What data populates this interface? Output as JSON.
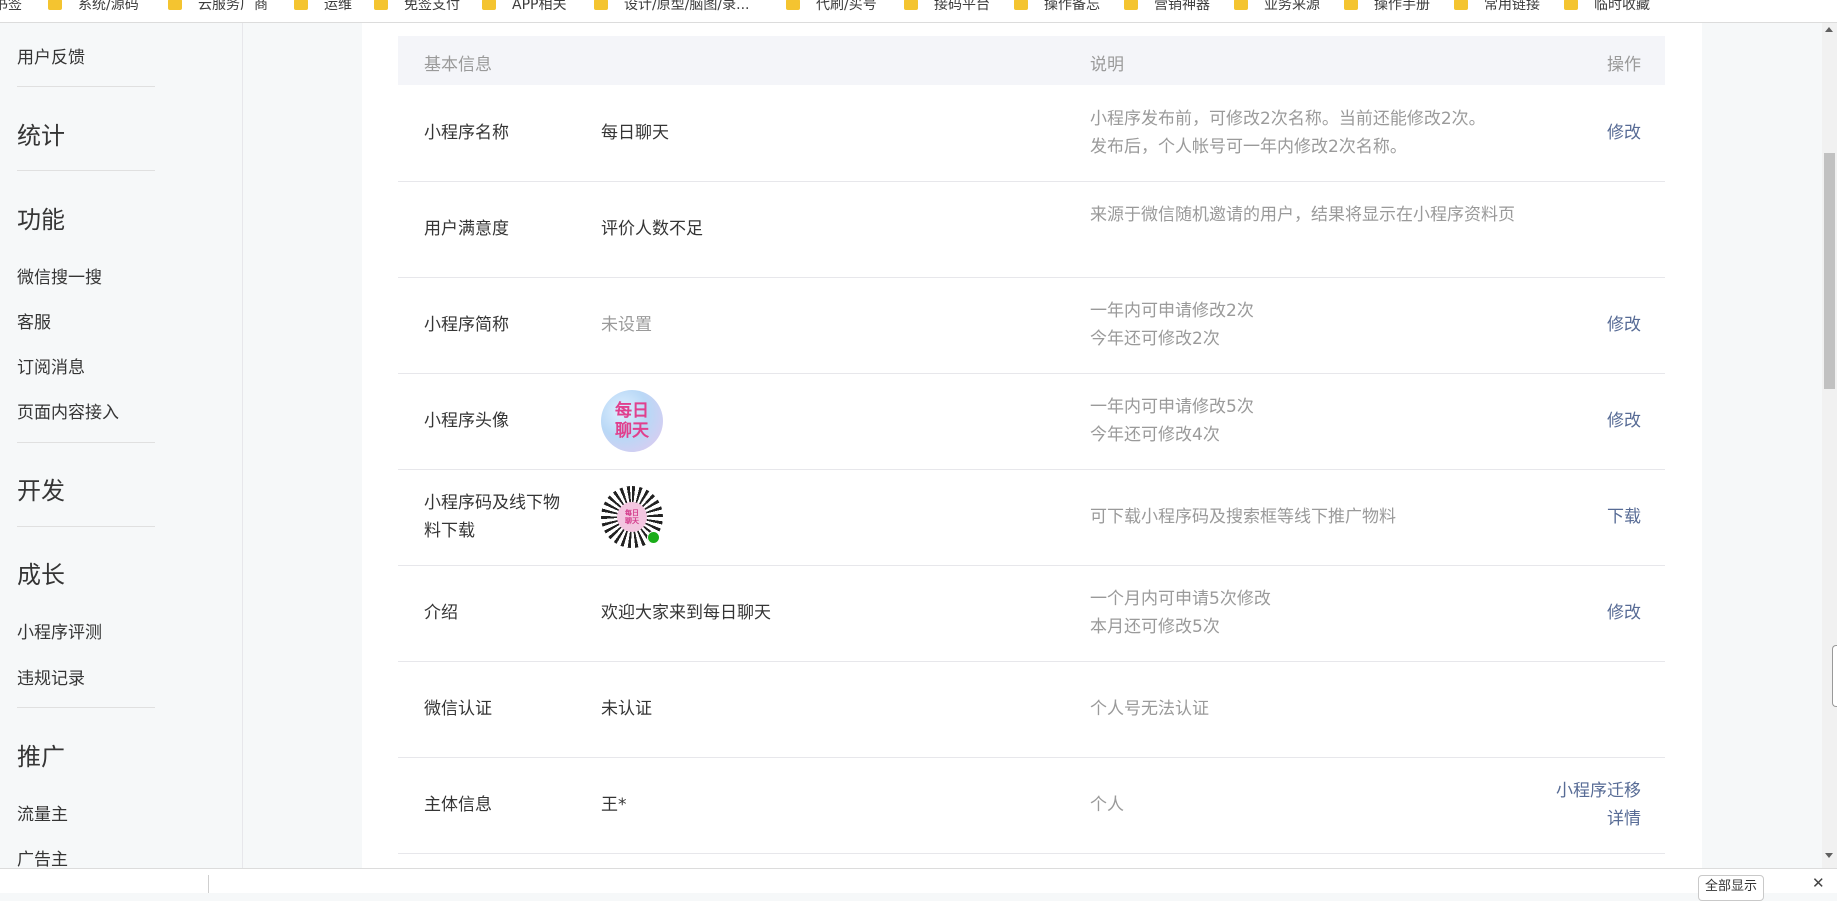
{
  "bookmarks": [
    "书签",
    "系统/源码",
    "云服务厂商",
    "运维",
    "免签支付",
    "APP相关",
    "设计/原型/脑图/录...",
    "代刷/买号",
    "接码平台",
    "操作备忘",
    "营销神器",
    "业务来源",
    "操作手册",
    "常用链接",
    "临时收藏"
  ],
  "sidebar": {
    "feedback": "用户反馈",
    "stats": "统计",
    "features": "功能",
    "wechat_search": "微信搜一搜",
    "customer_service": "客服",
    "subscribe_msg": "订阅消息",
    "page_content": "页面内容接入",
    "dev": "开发",
    "growth": "成长",
    "evaluation": "小程序评测",
    "violations": "违规记录",
    "promotion": "推广",
    "traffic_owner": "流量主",
    "advertiser": "广告主"
  },
  "table": {
    "header": {
      "basic_info": "基本信息",
      "description": "说明",
      "action": "操作"
    },
    "rows": [
      {
        "label": "小程序名称",
        "value": "每日聊天",
        "desc1": "小程序发布前，可修改2次名称。当前还能修改2次。",
        "desc2": "发布后，个人帐号可一年内修改2次名称。",
        "action": "修改"
      },
      {
        "label": "用户满意度",
        "value": "评价人数不足",
        "desc1": "来源于微信随机邀请的用户，结果将显示在小程序资料页",
        "desc2": "",
        "action": ""
      },
      {
        "label": "小程序简称",
        "value": "未设置",
        "desc1": "一年内可申请修改2次",
        "desc2": "今年还可修改2次",
        "action": "修改"
      },
      {
        "label": "小程序头像",
        "avatar_text1": "每日",
        "avatar_text2": "聊天",
        "desc1": "一年内可申请修改5次",
        "desc2": "今年还可修改4次",
        "action": "修改"
      },
      {
        "label": "小程序码及线下物料下载",
        "qr_text1": "每日",
        "qr_text2": "聊天",
        "desc1": "可下载小程序码及搜索框等线下推广物料",
        "desc2": "",
        "action": "下载"
      },
      {
        "label": "介绍",
        "value": "欢迎大家来到每日聊天",
        "desc1": "一个月内可申请5次修改",
        "desc2": "本月还可修改5次",
        "action": "修改"
      },
      {
        "label": "微信认证",
        "value": "未认证",
        "desc1": "个人号无法认证",
        "desc2": "",
        "action": ""
      },
      {
        "label": "主体信息",
        "value": "王*",
        "desc1": "个人",
        "desc2": "",
        "action1": "小程序迁移",
        "action2": "详情"
      }
    ]
  },
  "bottom": {
    "all_button": "全部显示"
  },
  "colors": {
    "link": "#576b95",
    "muted": "#9a9a9a",
    "text": "#353535",
    "sidebar_bg": "#f6f8f9",
    "folder": "#f4c430"
  }
}
